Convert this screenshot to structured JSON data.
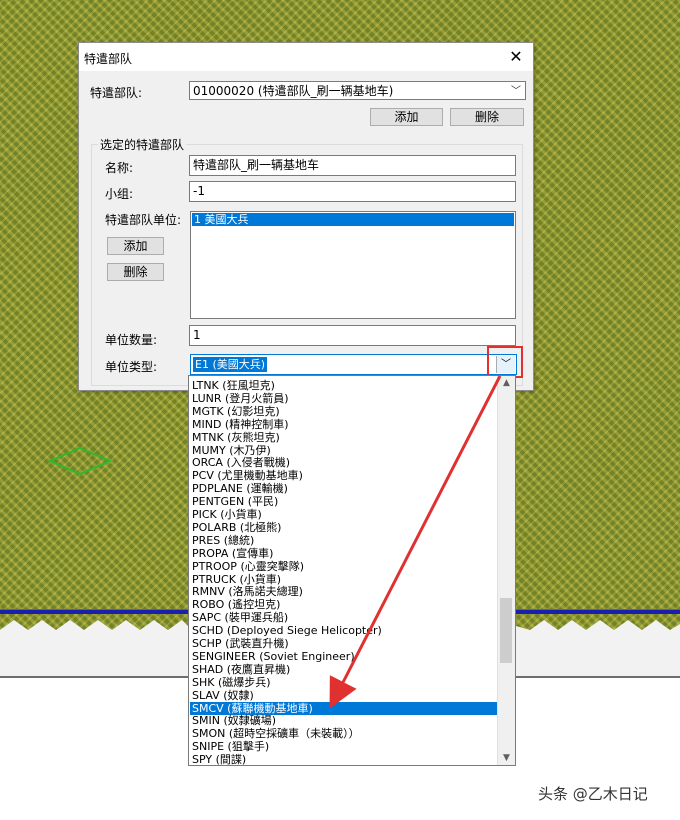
{
  "dialog": {
    "title": "特遣部队",
    "taskforce_label": "特遣部队:",
    "taskforce_value": "01000020 (特遣部队_刷一辆基地车)",
    "add_label": "添加",
    "delete_label": "删除",
    "group_title": "选定的特遣部队",
    "name_label": "名称:",
    "name_value": "特遣部队_刷一辆基地车",
    "group_label": "小组:",
    "group_value": "-1",
    "units_label": "特遣部队单位:",
    "units_items": [
      "1 美國大兵"
    ],
    "unit_add_label": "添加",
    "unit_delete_label": "删除",
    "count_label": "单位数量:",
    "count_value": "1",
    "type_label": "单位类型:",
    "type_value": "E1 (美國大兵)"
  },
  "dropdown": {
    "selected_index": 25,
    "items": [
      "LTNK (狂風坦克)",
      "LUNR (登月火箭員)",
      "MGTK (幻影坦克)",
      "MIND (精神控制車)",
      "MTNK (灰熊坦克)",
      "MUMY (木乃伊)",
      "ORCA (入侵者戰機)",
      "PCV (尤里機動基地車)",
      "PDPLANE (運輸機)",
      "PENTGEN (平民)",
      "PICK (小貨車)",
      "POLARB (北極熊)",
      "PRES (總統)",
      "PROPA (宣傳車)",
      "PTROOP (心靈突擊隊)",
      "PTRUCK (小貨車)",
      "RMNV (洛馬諾夫總理)",
      "ROBO (遙控坦克)",
      "SAPC (裝甲運兵船)",
      "SCHD (Deployed Siege Helicopter)",
      "SCHP (武裝直升機)",
      "SENGINEER (Soviet Engineer)",
      "SHAD (夜鷹直昇機)",
      "SHK (磁爆步兵)",
      "SLAV (奴隸)",
      "SMCV (蘇聯機動基地車)",
      "SMIN (奴隸礦場)",
      "SMON (超時空採礦車（未裝載））",
      "SNIPE (狙擊手)",
      "SPY (間諜)"
    ]
  },
  "watermark": "头条 @乙木日记",
  "colors": {
    "selection": "#0078d7",
    "annotation_red": "#e03030",
    "map_blue_line": "#1a1fb0"
  }
}
